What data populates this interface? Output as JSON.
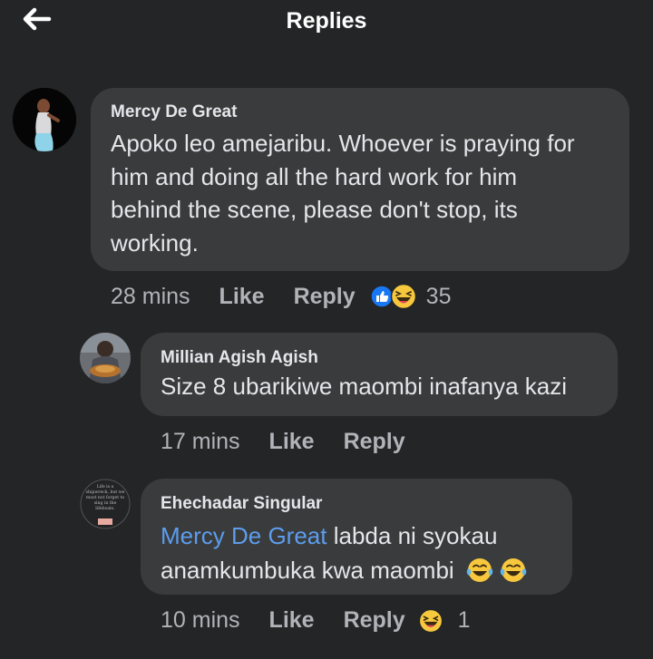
{
  "header": {
    "title": "Replies",
    "back_icon": "arrow-left-icon"
  },
  "comments": [
    {
      "author": "Mercy De Great",
      "lines": [
        "Apoko leo amejaribu. Whoever is praying for",
        "him and doing all the hard work for him",
        "behind the scene, please don't stop, its",
        "working."
      ],
      "time": "28 mins",
      "like_label": "Like",
      "reply_label": "Reply",
      "reaction_icons": [
        "like-reaction-icon",
        "haha-reaction-icon"
      ],
      "reaction_count": "35"
    },
    {
      "author": "Millian Agish Agish",
      "text": "Size 8 ubarikiwe maombi inafanya kazi",
      "time": "17 mins",
      "like_label": "Like",
      "reply_label": "Reply"
    },
    {
      "author": "Ehechadar Singular",
      "mention": "Mercy De Great",
      "line1_rest": "labda ni syokau",
      "line2": "anamkumbuka kwa maombi",
      "inline_emojis": [
        "tears-of-joy-emoji",
        "tears-of-joy-emoji"
      ],
      "time": "10 mins",
      "like_label": "Like",
      "reply_label": "Reply",
      "reaction_icons": [
        "haha-reaction-icon"
      ],
      "reaction_count": "1",
      "avatar_text": [
        "Life is a",
        "shipwreck, but we",
        "must not forget to",
        "sing in the",
        "lifeboats."
      ]
    }
  ],
  "colors": {
    "background": "#242526",
    "bubble": "#3a3b3c",
    "text": "#e4e6eb",
    "secondary": "#b0b3b8",
    "mention": "#5c9ded",
    "like_blue": "#1877f2",
    "haha_yellow": "#f7c83e"
  }
}
